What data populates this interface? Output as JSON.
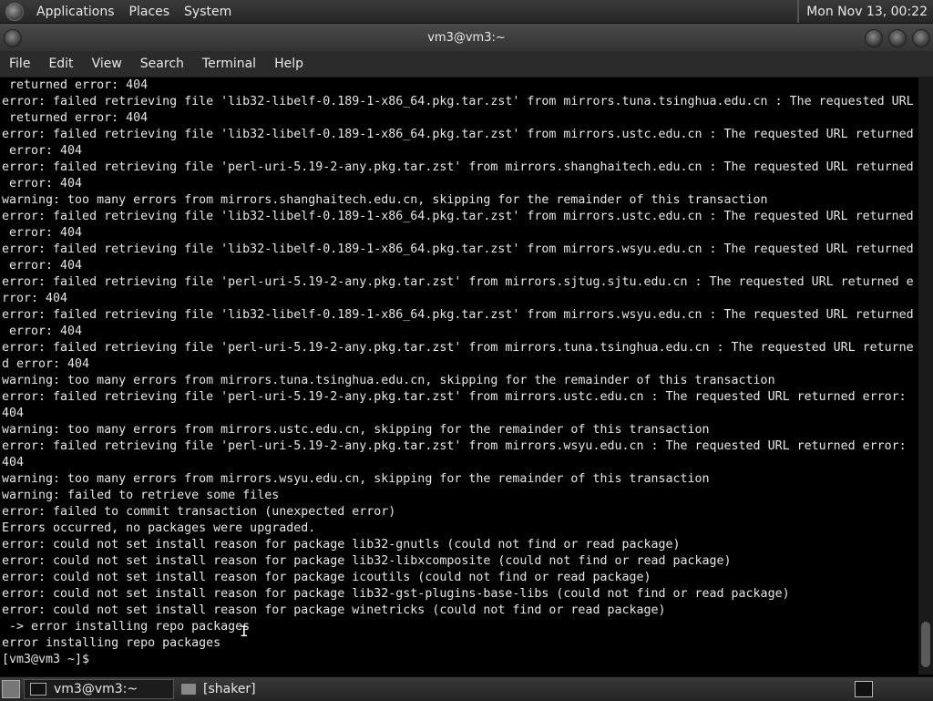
{
  "topbar": {
    "menus": [
      "Applications",
      "Places",
      "System"
    ],
    "clock": "Mon Nov 13, 00:22"
  },
  "window": {
    "title": "vm3@vm3:~"
  },
  "menubar": {
    "items": [
      "File",
      "Edit",
      "View",
      "Search",
      "Terminal",
      "Help"
    ]
  },
  "terminal": {
    "lines": [
      " returned error: 404",
      "error: failed retrieving file 'lib32-libelf-0.189-1-x86_64.pkg.tar.zst' from mirrors.tuna.tsinghua.edu.cn : The requested URL",
      " returned error: 404",
      "error: failed retrieving file 'lib32-libelf-0.189-1-x86_64.pkg.tar.zst' from mirrors.ustc.edu.cn : The requested URL returned",
      " error: 404",
      "error: failed retrieving file 'perl-uri-5.19-2-any.pkg.tar.zst' from mirrors.shanghaitech.edu.cn : The requested URL returned",
      " error: 404",
      "warning: too many errors from mirrors.shanghaitech.edu.cn, skipping for the remainder of this transaction",
      "error: failed retrieving file 'lib32-libelf-0.189-1-x86_64.pkg.tar.zst' from mirrors.ustc.edu.cn : The requested URL returned",
      " error: 404",
      "error: failed retrieving file 'lib32-libelf-0.189-1-x86_64.pkg.tar.zst' from mirrors.wsyu.edu.cn : The requested URL returned",
      " error: 404",
      "error: failed retrieving file 'perl-uri-5.19-2-any.pkg.tar.zst' from mirrors.sjtug.sjtu.edu.cn : The requested URL returned e",
      "rror: 404",
      "error: failed retrieving file 'lib32-libelf-0.189-1-x86_64.pkg.tar.zst' from mirrors.wsyu.edu.cn : The requested URL returned",
      " error: 404",
      "error: failed retrieving file 'perl-uri-5.19-2-any.pkg.tar.zst' from mirrors.tuna.tsinghua.edu.cn : The requested URL returne",
      "d error: 404",
      "warning: too many errors from mirrors.tuna.tsinghua.edu.cn, skipping for the remainder of this transaction",
      "error: failed retrieving file 'perl-uri-5.19-2-any.pkg.tar.zst' from mirrors.ustc.edu.cn : The requested URL returned error:",
      "404",
      "warning: too many errors from mirrors.ustc.edu.cn, skipping for the remainder of this transaction",
      "error: failed retrieving file 'perl-uri-5.19-2-any.pkg.tar.zst' from mirrors.wsyu.edu.cn : The requested URL returned error:",
      "404",
      "warning: too many errors from mirrors.wsyu.edu.cn, skipping for the remainder of this transaction",
      "warning: failed to retrieve some files",
      "error: failed to commit transaction (unexpected error)",
      "Errors occurred, no packages were upgraded.",
      "error: could not set install reason for package lib32-gnutls (could not find or read package)",
      "error: could not set install reason for package lib32-libxcomposite (could not find or read package)",
      "error: could not set install reason for package icoutils (could not find or read package)",
      "error: could not set install reason for package lib32-gst-plugins-base-libs (could not find or read package)",
      "error: could not set install reason for package winetricks (could not find or read package)",
      " -> error installing repo packages",
      "error installing repo packages",
      "[vm3@vm3 ~]$ "
    ]
  },
  "taskbar": {
    "items": [
      {
        "label": "vm3@vm3:~",
        "icon": "terminal-icon",
        "active": true
      },
      {
        "label": "[shaker]",
        "icon": "folder-icon",
        "active": false
      }
    ]
  }
}
